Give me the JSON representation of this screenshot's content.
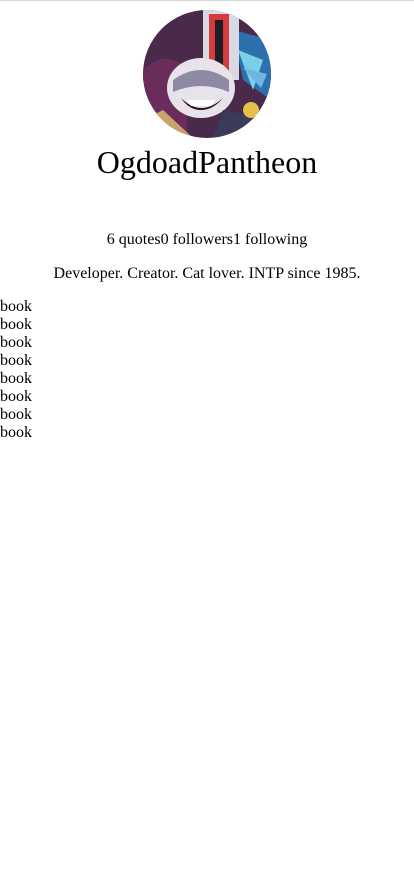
{
  "profile": {
    "avatar_icon": "user-avatar-image",
    "username": "OgdoadPantheon",
    "stats": {
      "quotes": "6 quotes",
      "followers": "0 followers",
      "following": "1 following"
    },
    "bio": "Developer. Creator. Cat lover. INTP since 1985."
  },
  "books": [
    "book",
    "book",
    "book",
    "book",
    "book",
    "book",
    "book",
    "book"
  ]
}
